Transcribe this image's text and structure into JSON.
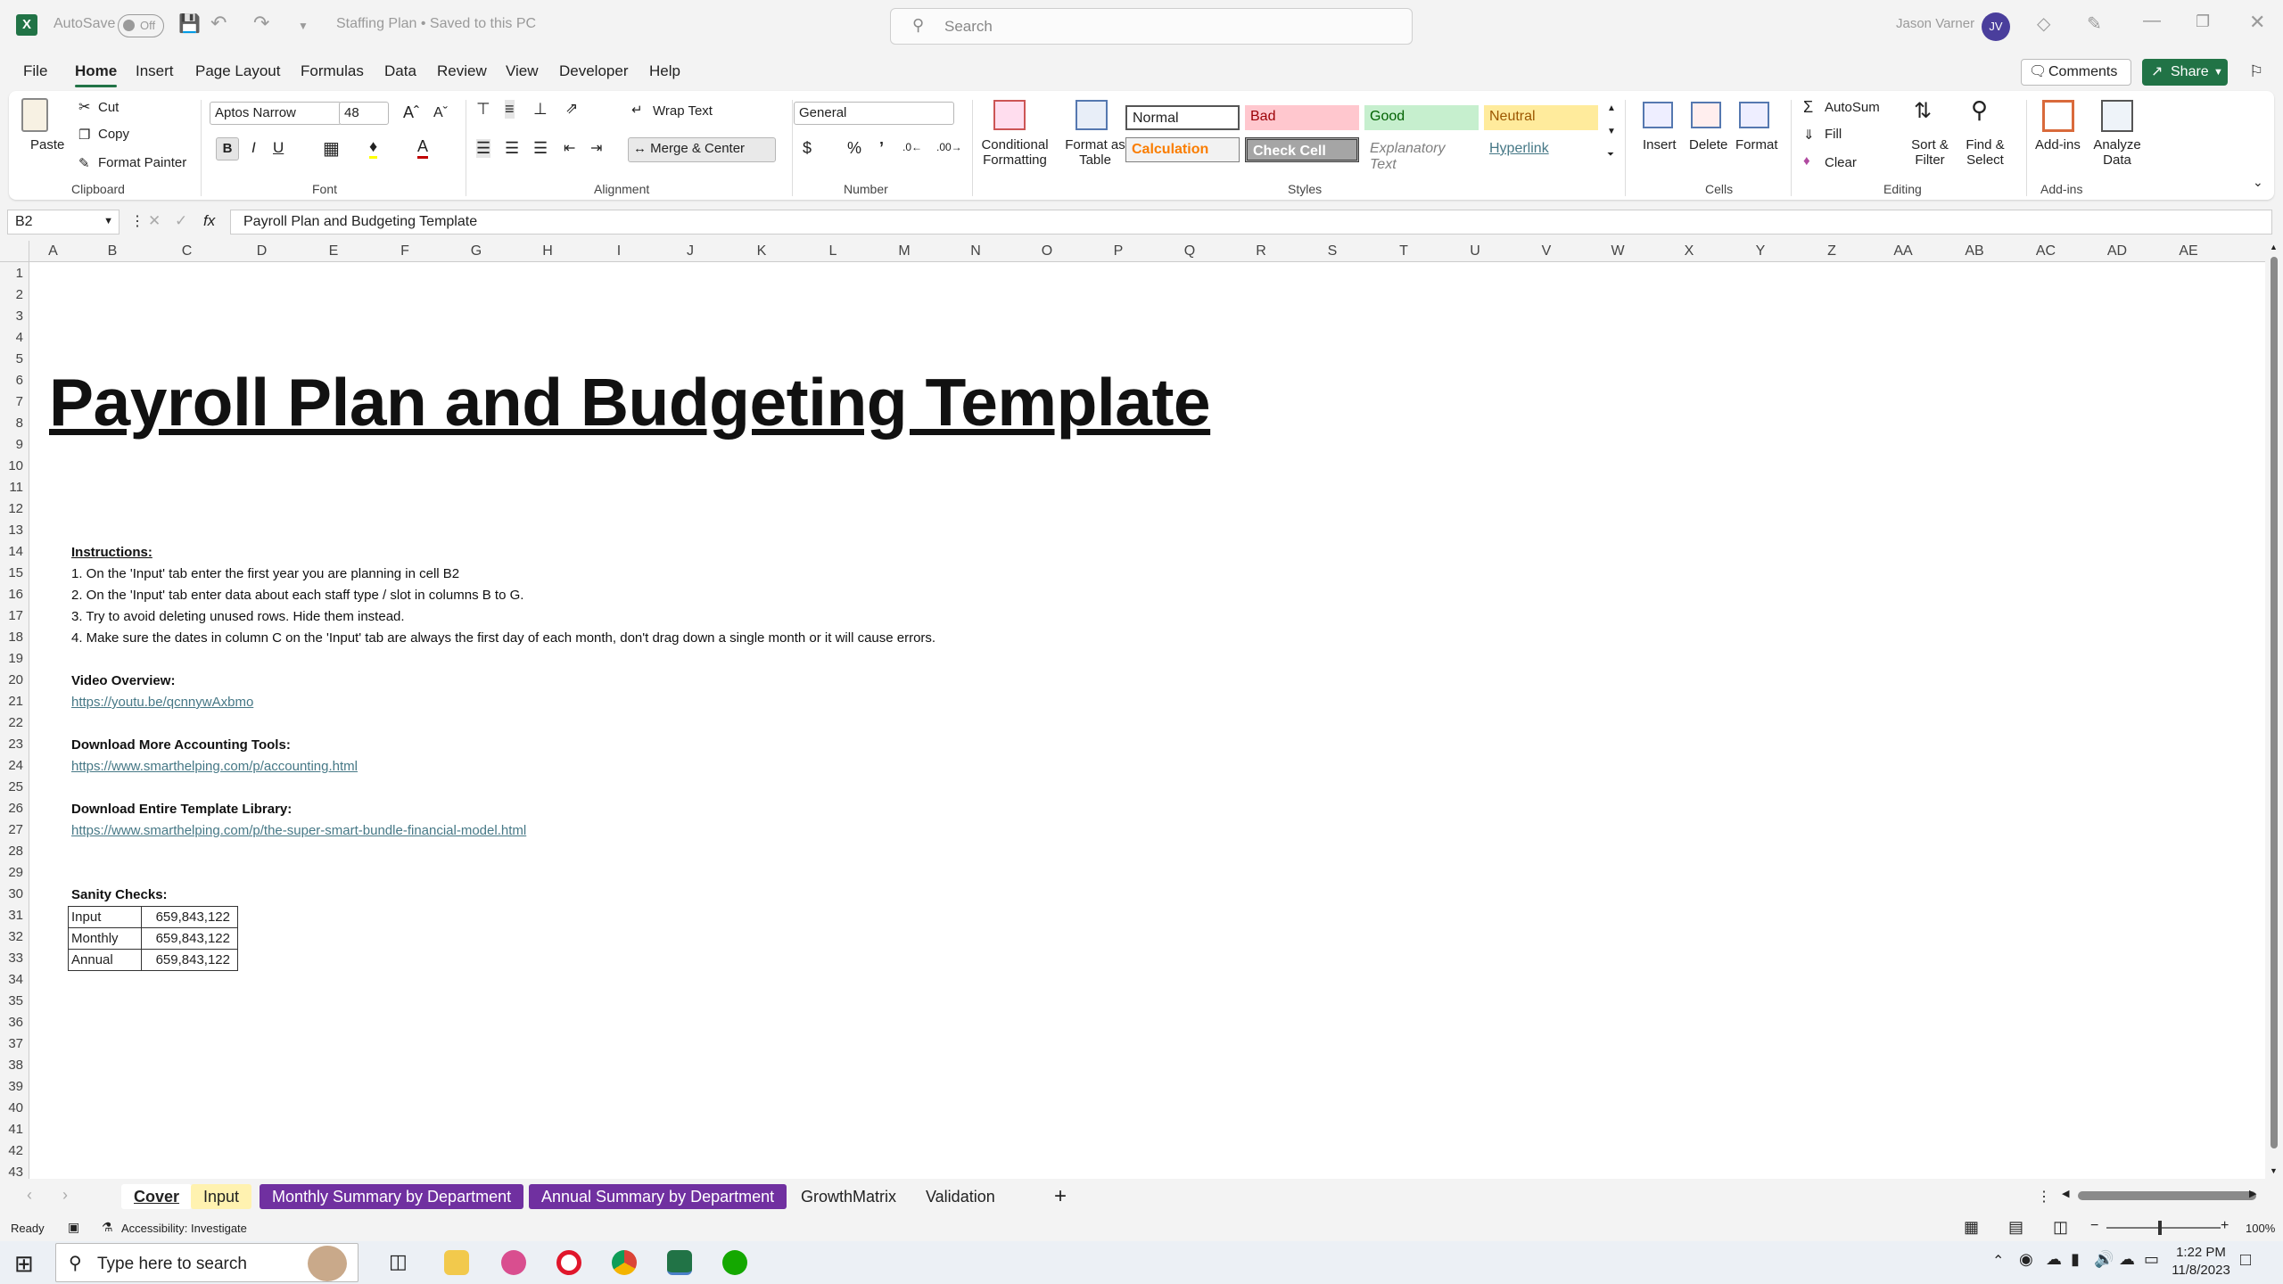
{
  "titlebar": {
    "autosave_label": "AutoSave",
    "autosave_state": "Off",
    "doc_title": "Staffing Plan • Saved to this PC",
    "search_placeholder": "Search",
    "user_name": "Jason Varner",
    "user_initials": "JV"
  },
  "menu": {
    "items": [
      "File",
      "Home",
      "Insert",
      "Page Layout",
      "Formulas",
      "Data",
      "Review",
      "View",
      "Developer",
      "Help"
    ],
    "active": "Home",
    "comments_label": "Comments",
    "share_label": "Share"
  },
  "ribbon": {
    "clipboard": {
      "paste": "Paste",
      "cut": "Cut",
      "copy": "Copy",
      "format_painter": "Format Painter",
      "group": "Clipboard"
    },
    "font": {
      "name": "Aptos Narrow",
      "size": "48",
      "group": "Font"
    },
    "alignment": {
      "wrap": "Wrap Text",
      "merge": "Merge & Center",
      "group": "Alignment"
    },
    "number": {
      "format": "General",
      "group": "Number"
    },
    "styles": {
      "conditional": "Conditional Formatting",
      "format_table": "Format as Table",
      "normal": "Normal",
      "bad": "Bad",
      "good": "Good",
      "neutral": "Neutral",
      "calculation": "Calculation",
      "check_cell": "Check Cell",
      "explanatory": "Explanatory Text",
      "hyperlink": "Hyperlink",
      "group": "Styles"
    },
    "cells": {
      "insert": "Insert",
      "delete": "Delete",
      "format": "Format",
      "group": "Cells"
    },
    "editing": {
      "autosum": "AutoSum",
      "fill": "Fill",
      "clear": "Clear",
      "sort": "Sort & Filter",
      "find": "Find & Select",
      "group": "Editing"
    },
    "addins": {
      "addins": "Add-ins",
      "analyze": "Analyze Data",
      "group": "Add-ins"
    }
  },
  "formula_bar": {
    "name_box": "B2",
    "formula": "Payroll Plan and Budgeting Template"
  },
  "columns": [
    "A",
    "B",
    "C",
    "D",
    "E",
    "F",
    "G",
    "H",
    "I",
    "J",
    "K",
    "L",
    "M",
    "N",
    "O",
    "P",
    "Q",
    "R",
    "S",
    "T",
    "U",
    "V",
    "W",
    "X",
    "Y",
    "Z",
    "AA",
    "AB",
    "AC",
    "AD",
    "AE"
  ],
  "rows": [
    "1",
    "2",
    "3",
    "4",
    "5",
    "6",
    "7",
    "8",
    "9",
    "10",
    "11",
    "12",
    "13",
    "14",
    "15",
    "16",
    "17",
    "18",
    "19",
    "20",
    "21",
    "22",
    "23",
    "24",
    "25",
    "26",
    "27",
    "28",
    "29",
    "30",
    "31",
    "32",
    "33",
    "34",
    "35",
    "36",
    "37",
    "38",
    "39",
    "40",
    "41",
    "42",
    "43"
  ],
  "sheet": {
    "title": "Payroll Plan and Budgeting Template",
    "instructions_heading": "Instructions:",
    "instructions": [
      "1. On the 'Input' tab enter the first year you are planning in cell B2",
      "2. On the 'Input' tab enter data about each staff type / slot in columns B to G.",
      "3. Try to avoid deleting unused rows. Hide them instead.",
      "4. Make sure the dates in column C on the 'Input' tab are always the first day of each month, don't drag down a single month or it will cause errors."
    ],
    "video_heading": "Video Overview:",
    "video_link": "https://youtu.be/qcnnywAxbmo",
    "download_heading": "Download More Accounting Tools:",
    "download_link": "https://www.smarthelping.com/p/accounting.html",
    "library_heading": "Download Entire Template Library:",
    "library_link": "https://www.smarthelping.com/p/the-super-smart-bundle-financial-model.html",
    "sanity_heading": "Sanity Checks:",
    "sanity": [
      {
        "label": "Input",
        "value": "659,843,122"
      },
      {
        "label": "Monthly",
        "value": "659,843,122"
      },
      {
        "label": "Annual",
        "value": "659,843,122"
      }
    ]
  },
  "tabs": [
    {
      "label": "Cover",
      "style": "active"
    },
    {
      "label": "Input",
      "style": "yellow"
    },
    {
      "label": "Monthly Summary by Department",
      "style": "purple"
    },
    {
      "label": "Annual Summary by Department",
      "style": "purple"
    },
    {
      "label": "GrowthMatrix",
      "style": "plain"
    },
    {
      "label": "Validation",
      "style": "plain"
    }
  ],
  "status": {
    "ready": "Ready",
    "accessibility": "Accessibility: Investigate",
    "zoom": "100%"
  },
  "taskbar": {
    "search_placeholder": "Type here to search",
    "time": "1:22 PM",
    "date": "11/8/2023"
  },
  "colors": {
    "excel_green": "#217346",
    "purple_tab": "#7030a0",
    "yellow_tab": "#fff2b0",
    "link": "#467886"
  }
}
